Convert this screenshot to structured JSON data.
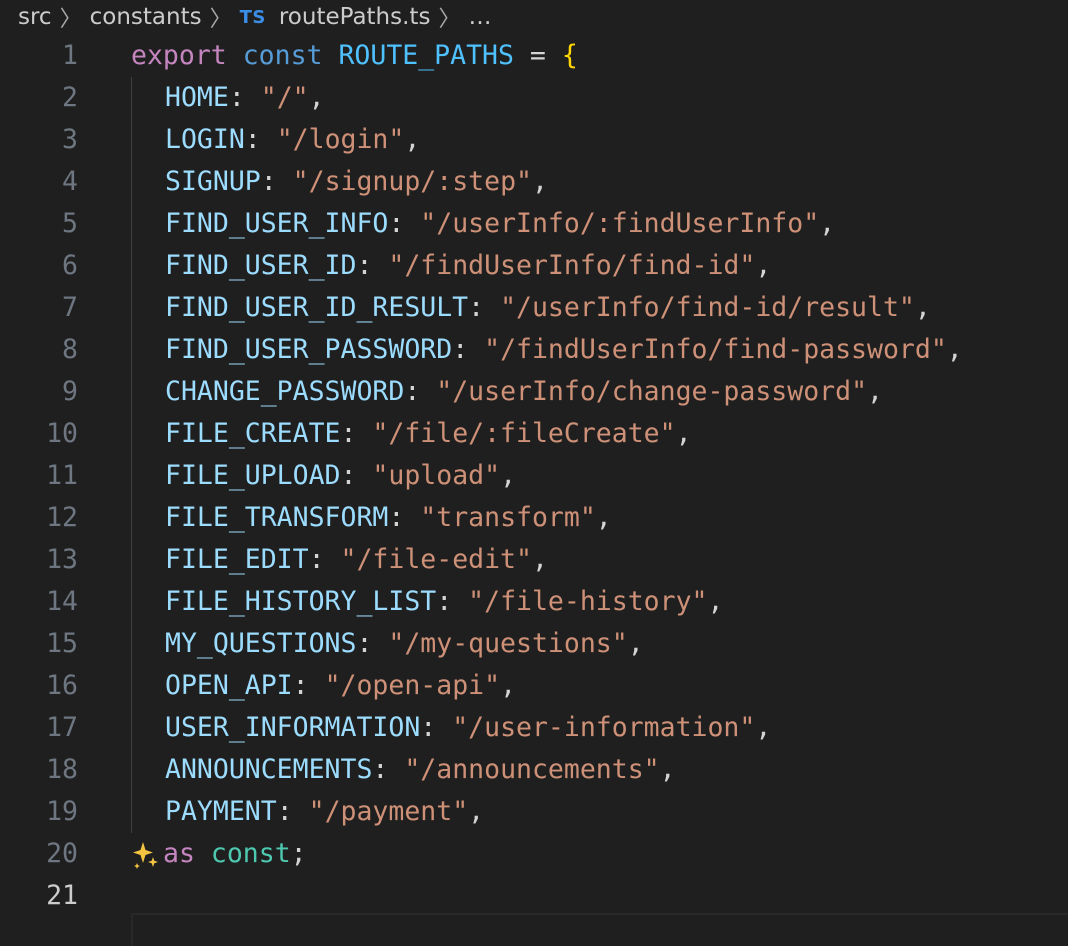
{
  "breadcrumb": {
    "items": [
      "src",
      "constants",
      "routePaths.ts",
      "…"
    ],
    "file_badge": "TS"
  },
  "editor": {
    "active_line": 21,
    "decl": {
      "keyword_export": "export",
      "keyword_const": "const",
      "name": "ROUTE_PATHS",
      "eq": " = ",
      "open": "{"
    },
    "entries": [
      {
        "key": "HOME",
        "value": "\"/\""
      },
      {
        "key": "LOGIN",
        "value": "\"/login\""
      },
      {
        "key": "SIGNUP",
        "value": "\"/signup/:step\""
      },
      {
        "key": "FIND_USER_INFO",
        "value": "\"/userInfo/:findUserInfo\""
      },
      {
        "key": "FIND_USER_ID",
        "value": "\"/findUserInfo/find-id\""
      },
      {
        "key": "FIND_USER_ID_RESULT",
        "value": "\"/userInfo/find-id/result\""
      },
      {
        "key": "FIND_USER_PASSWORD",
        "value": "\"/findUserInfo/find-password\""
      },
      {
        "key": "CHANGE_PASSWORD",
        "value": "\"/userInfo/change-password\""
      },
      {
        "key": "FILE_CREATE",
        "value": "\"/file/:fileCreate\""
      },
      {
        "key": "FILE_UPLOAD",
        "value": "\"upload\""
      },
      {
        "key": "FILE_TRANSFORM",
        "value": "\"transform\""
      },
      {
        "key": "FILE_EDIT",
        "value": "\"/file-edit\""
      },
      {
        "key": "FILE_HISTORY_LIST",
        "value": "\"/file-history\""
      },
      {
        "key": "MY_QUESTIONS",
        "value": "\"/my-questions\""
      },
      {
        "key": "OPEN_API",
        "value": "\"/open-api\""
      },
      {
        "key": "USER_INFORMATION",
        "value": "\"/user-information\""
      },
      {
        "key": "ANNOUNCEMENTS",
        "value": "\"/announcements\""
      },
      {
        "key": "PAYMENT",
        "value": "\"/payment\""
      }
    ],
    "closing": {
      "keyword_as": "as",
      "keyword_const": "const",
      "semicolon": ";",
      "icon": "sparkle-icon"
    },
    "colors": {
      "keyword": "#c586c0",
      "storage": "#569cd6",
      "constant": "#4fc1ff",
      "property": "#9cdcfe",
      "string": "#ce9178",
      "brace": "#ffd700",
      "type": "#4ec9b0"
    }
  }
}
